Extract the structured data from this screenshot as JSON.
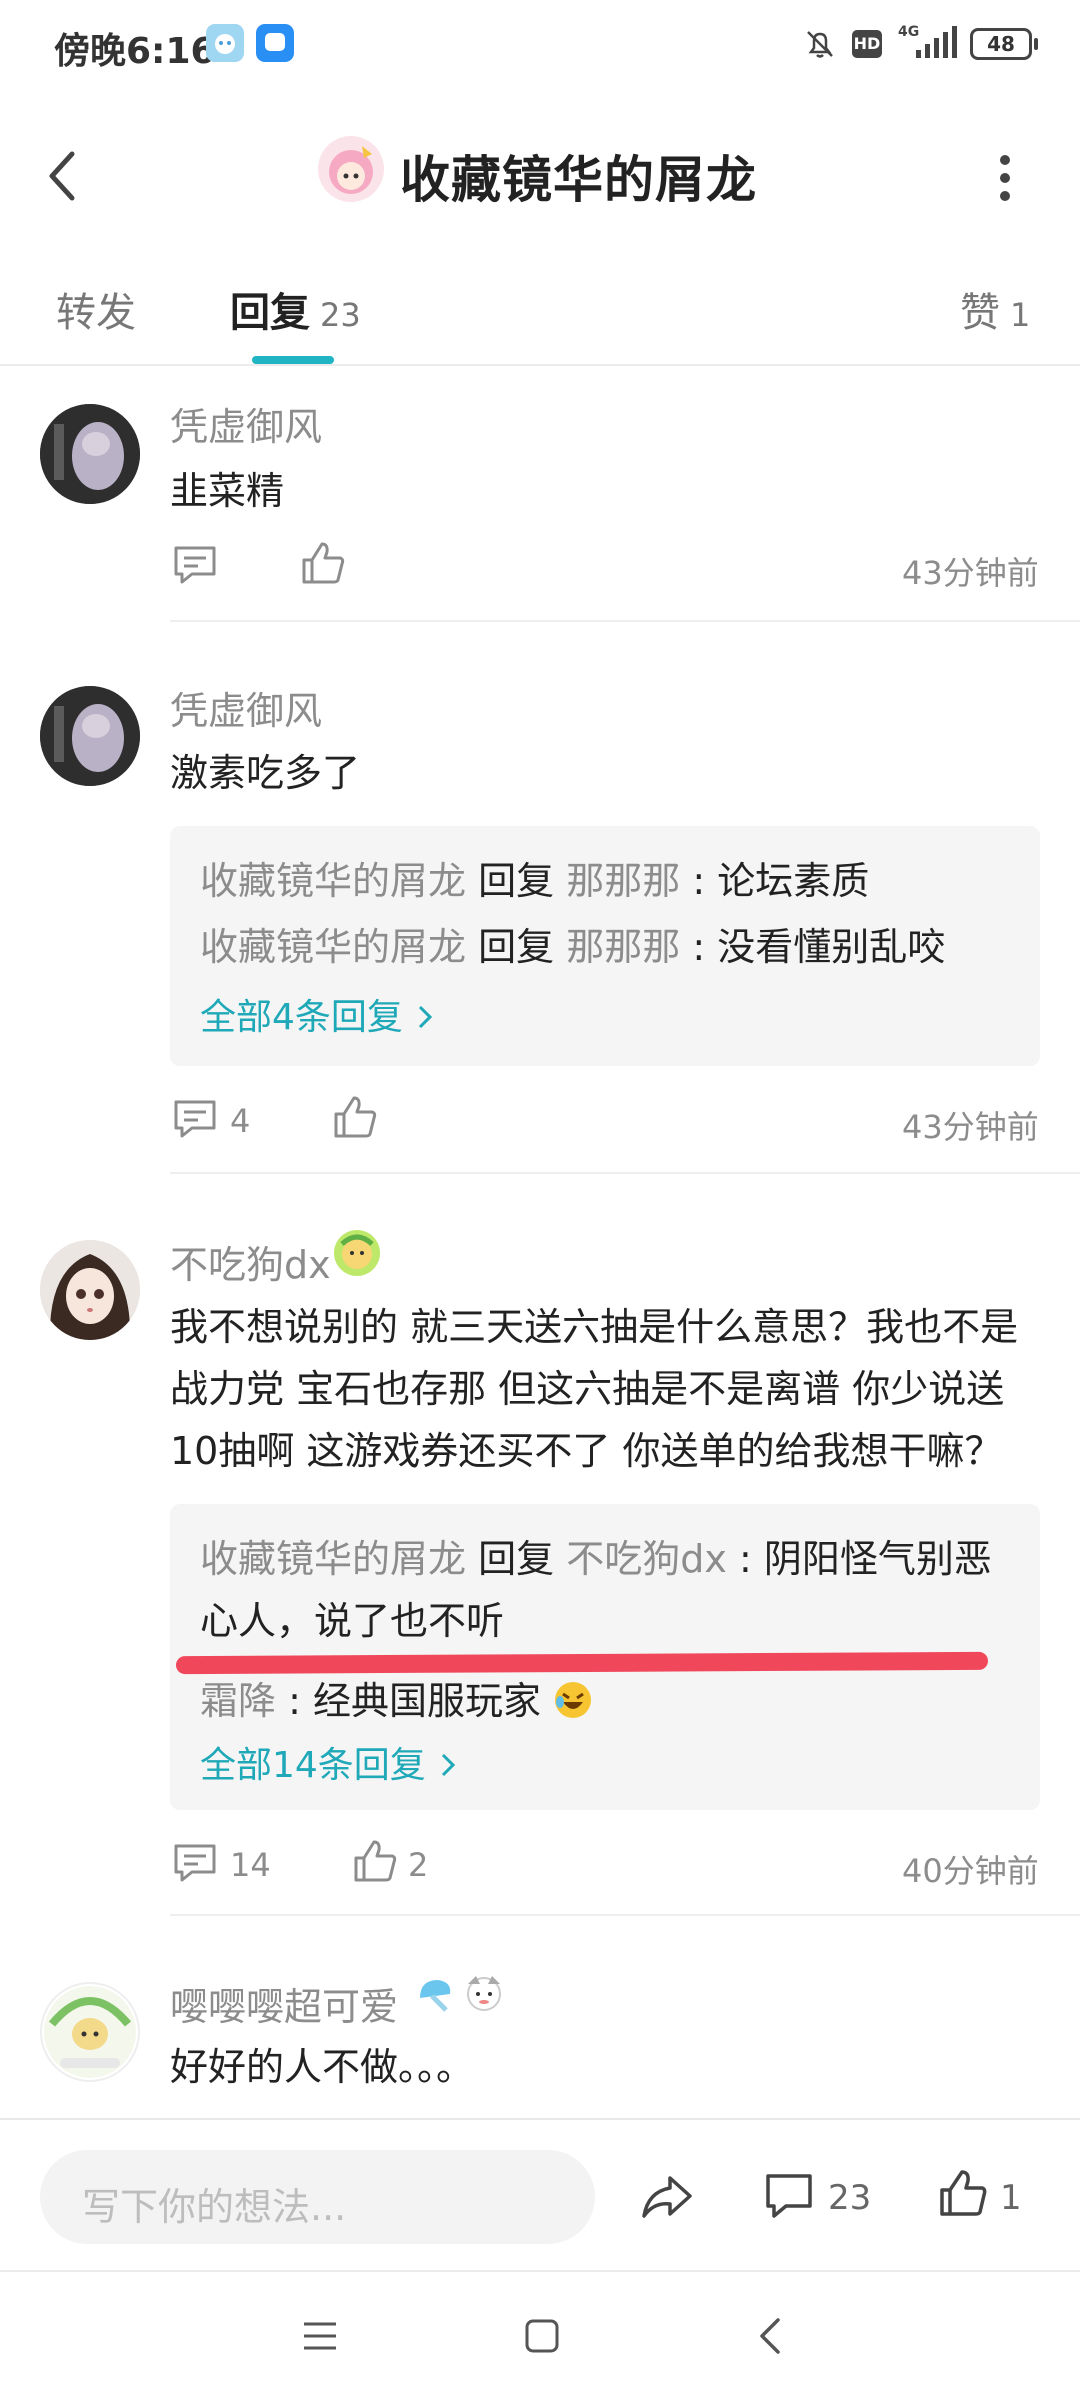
{
  "status_bar": {
    "time": "傍晚6:16",
    "network": "4G",
    "hd": "HD",
    "battery": "48"
  },
  "header": {
    "title": "收藏镜华的屑龙",
    "back_icon": "back-arrow-icon",
    "more_icon": "more-vertical-icon"
  },
  "tabs": [
    {
      "label": "转发",
      "count": ""
    },
    {
      "label": "回复",
      "count": "23"
    },
    {
      "label": "赞",
      "count": "1"
    }
  ],
  "comments": [
    {
      "user": "凭虚御风",
      "text": "韭菜精",
      "reply_count": "",
      "like_count": "",
      "time": "43分钟前"
    },
    {
      "user": "凭虚御风",
      "text": "激素吃多了",
      "replies": [
        {
          "from": "收藏镜华的屑龙",
          "verb": "回复",
          "to": "那那那",
          "sep": ":",
          "text": "论坛素质"
        },
        {
          "from": "收藏镜华的屑龙",
          "verb": "回复",
          "to": "那那那",
          "sep": ":",
          "text": "没看懂别乱咬"
        }
      ],
      "more_replies": "全部4条回复",
      "reply_count": "4",
      "like_count": "",
      "time": "43分钟前"
    },
    {
      "user": "不吃狗dx",
      "text_lines": [
        "我不想说别的 就三天送六抽是什么意思？我也不是",
        "战力党 宝石也存那 但这六抽是不是离谱 你少说送",
        "10抽啊 这游戏券还买不了 你送单的给我想干嘛？"
      ],
      "replies": [
        {
          "from": "收藏镜华的屑龙",
          "verb": "回复",
          "to": "不吃狗dx",
          "sep": ":",
          "text": "阴阳怪气别恶",
          "text2": "心人，说了也不听"
        },
        {
          "from": "霜降",
          "sep": ":",
          "text": "经典国服玩家"
        }
      ],
      "more_replies": "全部14条回复",
      "reply_count": "14",
      "like_count": "2",
      "time": "40分钟前"
    },
    {
      "user": "嘤嘤嘤超可爱",
      "text": "好好的人不做。。。"
    }
  ],
  "composer": {
    "placeholder": "写下你的想法...",
    "reply_count": "23",
    "like_count": "1"
  },
  "colors": {
    "accent": "#1fb5c4",
    "link": "#1fa9b8",
    "highlight_line": "#f0475b"
  }
}
